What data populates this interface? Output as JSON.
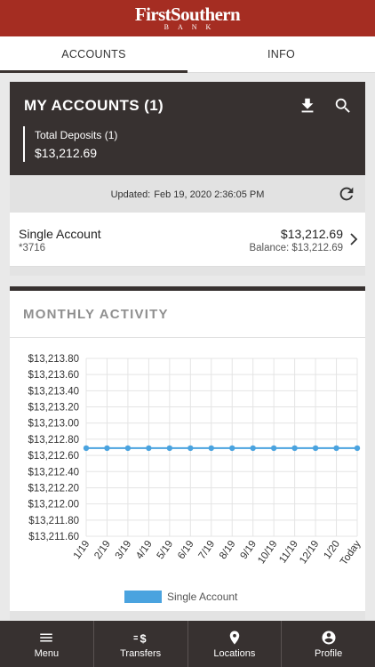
{
  "brand": {
    "name": "FirstSouthern",
    "sub": "BANK"
  },
  "tabs": [
    {
      "label": "ACCOUNTS",
      "active": true
    },
    {
      "label": "INFO",
      "active": false
    }
  ],
  "accounts_header": {
    "title": "MY ACCOUNTS (1)",
    "total_label": "Total Deposits (1)",
    "total_amount": "$13,212.69",
    "icons": [
      "download-icon",
      "search-icon"
    ]
  },
  "updated": {
    "label": "Updated:",
    "timestamp": "Feb 19, 2020 2:36:05 PM"
  },
  "account": {
    "name": "Single Account",
    "number": "*3716",
    "amount": "$13,212.69",
    "balance": "Balance: $13,212.69"
  },
  "activity": {
    "title": "MONTHLY ACTIVITY"
  },
  "chart_data": {
    "type": "line",
    "categories": [
      "1/19",
      "2/19",
      "3/19",
      "4/19",
      "5/19",
      "6/19",
      "7/19",
      "8/19",
      "9/19",
      "10/19",
      "11/19",
      "12/19",
      "1/20",
      "Today"
    ],
    "series": [
      {
        "name": "Single Account",
        "color": "#4aa3df",
        "values": [
          13212.69,
          13212.69,
          13212.69,
          13212.69,
          13212.69,
          13212.69,
          13212.69,
          13212.69,
          13212.69,
          13212.69,
          13212.69,
          13212.69,
          13212.69,
          13212.69
        ]
      }
    ],
    "yticks": [
      "$13,213.80",
      "$13,213.60",
      "$13,213.40",
      "$13,213.20",
      "$13,213.00",
      "$13,212.80",
      "$13,212.60",
      "$13,212.40",
      "$13,212.20",
      "$13,212.00",
      "$13,211.80",
      "$13,211.60"
    ],
    "ylim": [
      13211.6,
      13213.8
    ],
    "grid": true,
    "legend": "bottom-center"
  },
  "nav": [
    {
      "label": "Menu",
      "icon": "menu-icon"
    },
    {
      "label": "Transfers",
      "icon": "transfer-icon"
    },
    {
      "label": "Locations",
      "icon": "location-pin-icon"
    },
    {
      "label": "Profile",
      "icon": "profile-icon"
    }
  ]
}
